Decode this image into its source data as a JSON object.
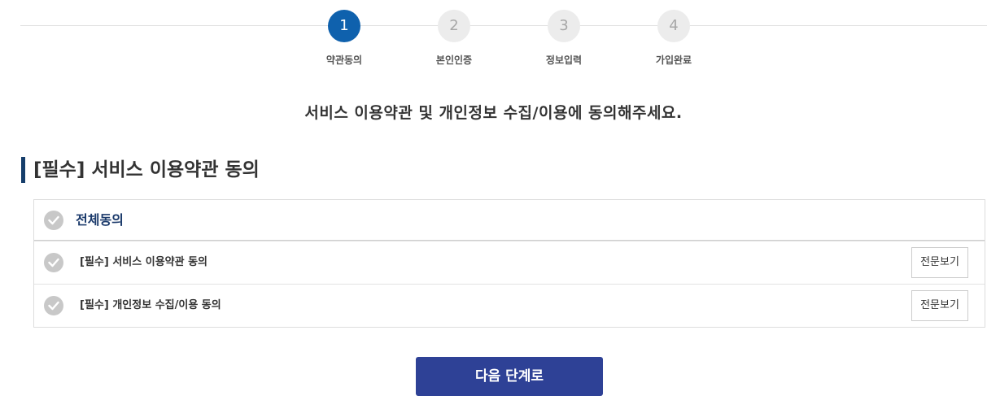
{
  "stepper": {
    "steps": [
      {
        "number": "1",
        "label": "약관동의",
        "active": true
      },
      {
        "number": "2",
        "label": "본인인증",
        "active": false
      },
      {
        "number": "3",
        "label": "정보입력",
        "active": false
      },
      {
        "number": "4",
        "label": "가입완료",
        "active": false
      }
    ]
  },
  "instruction": "서비스 이용약관 및 개인정보 수집/이용에 동의해주세요.",
  "section": {
    "title": "[필수] 서비스 이용약관 동의"
  },
  "agreements": {
    "all_label": "전체동의",
    "items": [
      {
        "label": "[필수] 서비스 이용약관 동의",
        "view_button": "전문보기"
      },
      {
        "label": "[필수] 개인정보 수집/이용 동의",
        "view_button": "전문보기"
      }
    ]
  },
  "next_button": "다음 단계로",
  "colors": {
    "active_step": "#0f61ad",
    "inactive_step": "#ececec",
    "section_bar": "#163e6b",
    "all_agree_text": "#1b3a6b",
    "check_inactive": "#c8c8c8",
    "primary_button": "#2e4196"
  },
  "icons": {
    "check": "check-circle-icon"
  }
}
